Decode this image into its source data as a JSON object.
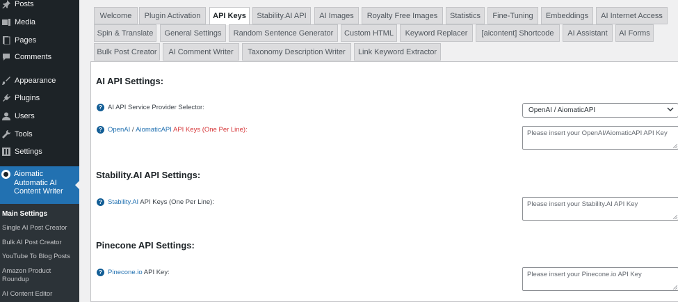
{
  "sidebar": {
    "menu": [
      {
        "label": "Posts",
        "icon": "pin-icon"
      },
      {
        "label": "Media",
        "icon": "media-icon"
      },
      {
        "label": "Pages",
        "icon": "pages-icon"
      },
      {
        "label": "Comments",
        "icon": "comments-icon"
      },
      {
        "label": "Appearance",
        "icon": "appearance-icon"
      },
      {
        "label": "Plugins",
        "icon": "plugins-icon"
      },
      {
        "label": "Users",
        "icon": "users-icon"
      },
      {
        "label": "Tools",
        "icon": "tools-icon"
      },
      {
        "label": "Settings",
        "icon": "settings-icon"
      }
    ],
    "active_plugin": "Aiomatic Automatic AI Content Writer",
    "submenu": [
      {
        "label": "Main Settings",
        "current": true
      },
      {
        "label": "Single AI Post Creator"
      },
      {
        "label": "Bulk AI Post Creator"
      },
      {
        "label": "YouTube To Blog Posts"
      },
      {
        "label": "Amazon Product Roundup"
      },
      {
        "label": "AI Content Editor"
      }
    ]
  },
  "tabs": [
    {
      "label": "Welcome"
    },
    {
      "label": "Plugin Activation"
    },
    {
      "label": "API Keys",
      "active": true
    },
    {
      "label": "Stability.AI API"
    },
    {
      "label": "AI Images"
    },
    {
      "label": "Royalty Free Images"
    },
    {
      "label": "Statistics"
    },
    {
      "label": "Fine-Tuning"
    },
    {
      "label": "Embeddings"
    },
    {
      "label": "AI Internet Access"
    },
    {
      "label": "Spin & Translate"
    },
    {
      "label": "General Settings"
    },
    {
      "label": "Random Sentence Generator"
    },
    {
      "label": "Custom HTML"
    },
    {
      "label": "Keyword Replacer"
    },
    {
      "label": "[aicontent] Shortcode"
    },
    {
      "label": "AI Assistant"
    },
    {
      "label": "AI Forms"
    },
    {
      "label": "Bulk Post Creator"
    },
    {
      "label": "AI Comment Writer"
    },
    {
      "label": "Taxonomy Description Writer"
    },
    {
      "label": "Link Keyword Extractor"
    }
  ],
  "sections": {
    "ai_api": {
      "title": "AI API Settings:",
      "provider_label": "AI API Service Provider Selector:",
      "provider_value": "OpenAI / AiomaticAPI",
      "keys_label_link1": "OpenAI",
      "keys_label_sep": " / ",
      "keys_label_link2": "AiomaticAPI",
      "keys_label_mid": " API Keys ",
      "keys_label_red": "(One Per Line):",
      "keys_placeholder": "Please insert your OpenAI/AiomaticAPI API Key"
    },
    "stability": {
      "title": "Stability.AI API Settings:",
      "label_link": "Stability.AI",
      "label_rest": " API Keys (One Per Line):",
      "placeholder": "Please insert your Stability.AI API Key"
    },
    "pinecone": {
      "title": "Pinecone API Settings:",
      "label_link": "Pinecone.io",
      "label_rest": " API Key:",
      "placeholder": "Please insert your Pinecone.io API Key"
    }
  },
  "help_glyph": "?"
}
